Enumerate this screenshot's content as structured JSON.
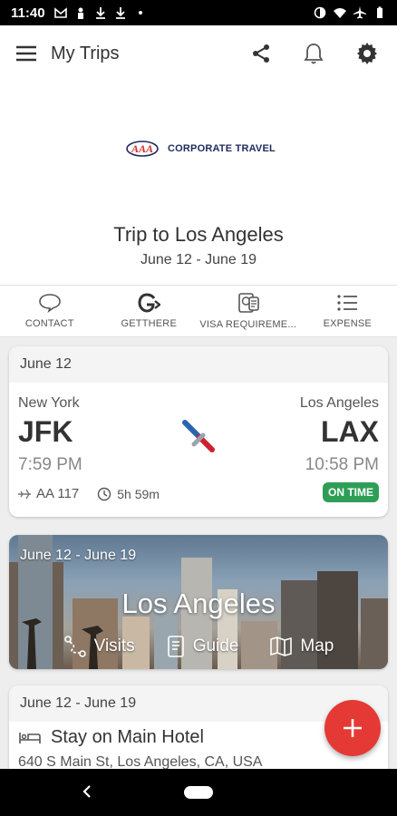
{
  "status_bar": {
    "time": "11:40"
  },
  "app_bar": {
    "title": "My Trips"
  },
  "brand": {
    "name": "CORPORATE TRAVEL"
  },
  "trip": {
    "title": "Trip to Los Angeles",
    "dates": "June 12 - June 19"
  },
  "quick_actions": [
    {
      "label": "CONTACT",
      "icon": "chat-bubble-icon"
    },
    {
      "label": "GETTHERE",
      "icon": "getthere-icon"
    },
    {
      "label": "VISA REQUIREME...",
      "icon": "passport-icon"
    },
    {
      "label": "EXPENSE",
      "icon": "list-icon"
    }
  ],
  "flight": {
    "date": "June 12",
    "from_city": "New York",
    "from_code": "JFK",
    "depart_time": "7:59 PM",
    "to_city": "Los Angeles",
    "to_code": "LAX",
    "arrive_time": "10:58 PM",
    "flight_number": "AA 117",
    "duration": "5h 59m",
    "status": "ON TIME"
  },
  "destination": {
    "dates": "June 12 - June 19",
    "city": "Los Angeles",
    "actions": [
      {
        "label": "Visits",
        "icon": "visits-icon"
      },
      {
        "label": "Guide",
        "icon": "guide-icon"
      },
      {
        "label": "Map",
        "icon": "map-icon"
      }
    ]
  },
  "hotel": {
    "dates": "June 12 - June 19",
    "name": "Stay on Main Hotel",
    "address": "640 S Main St, Los Angeles, CA, USA"
  },
  "colors": {
    "accent_red": "#e53935",
    "on_time_green": "#2e9e57",
    "brand_navy": "#1f2a5c"
  }
}
